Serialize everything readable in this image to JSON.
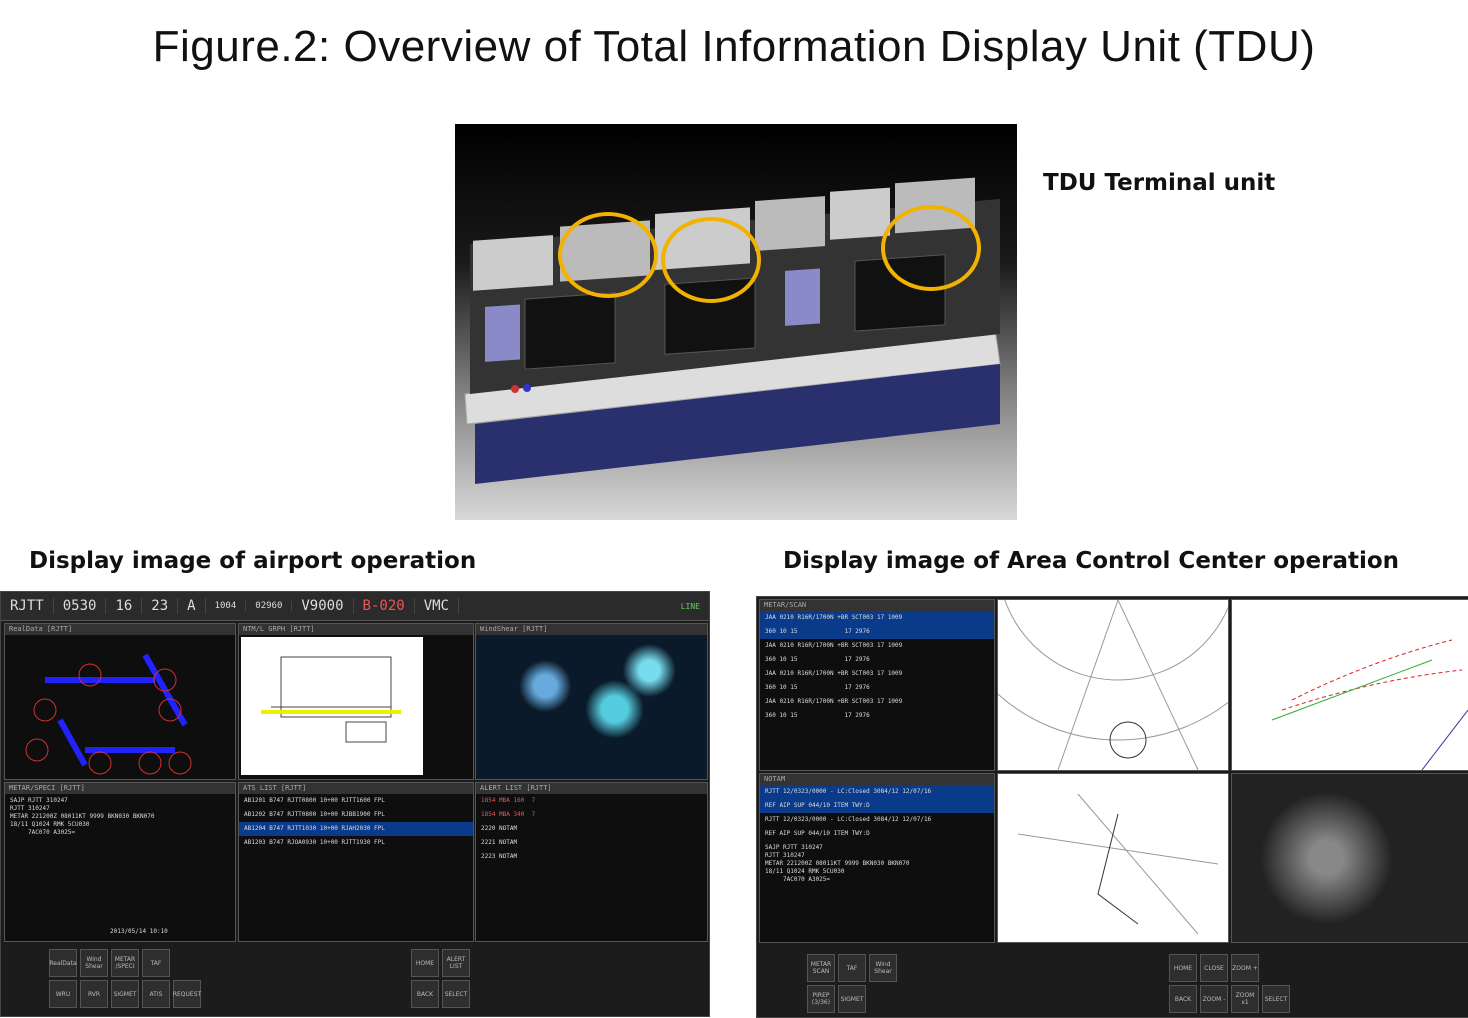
{
  "figure_title": "Figure.2: Overview of  Total Information Display Unit (TDU)",
  "captions": {
    "tdu_terminal": "TDU Terminal unit",
    "airport": "Display image of airport operation",
    "acc": "Display image of Area Control Center operation"
  },
  "airport_screen": {
    "topbar": [
      "RJTT",
      "0530",
      "16",
      "23",
      "A",
      "1004",
      "02960",
      "V9000",
      "B-020",
      "VMC",
      "LINE"
    ],
    "panels": {
      "realdata": "RealData [RJTT]",
      "ntm": "NTM/L GRPH [RJTT]",
      "windshear": "WindShear [RJTT]",
      "metar": "METAR/SPECI [RJTT]",
      "ats": "ATS LIST [RJTT]",
      "alert": "ALERT LIST [RJTT]"
    },
    "metar_text": "SAJP RJTT 310247\nRJTT 310247\nMETAR 221200Z 08011KT 9999 BKN030 BKN070\n18/11 Q1024 RMK 5CU030\n     7AC070 A3025=",
    "ats_rows": [
      "AB1201 B747 RJTT0800 10+00 RJTT1600 FPL",
      "AB1202 B747 RJTT0800 10+00 RJBB1900 FPL",
      "AB1204 B747 RJTT1030 10+00 RJAH2030 FPL",
      "AB1203 B747 RJOA0930 10+00 RJTT1930 FPL"
    ],
    "alert_rows": [
      "1854 MBA 160  7",
      "1854 MBA 340  7",
      "2220 NOTAM",
      "2221 NOTAM",
      "2223 NOTAM"
    ],
    "timestamp": "2013/05/14 10:10",
    "buttons": [
      "RealData",
      "Wind Shear",
      "METAR /SPECI",
      "TAF",
      "WRU",
      "RVR",
      "SIGMET",
      "ATIS",
      "REQUEST",
      "HOME",
      "BACK",
      "ALERT LIST",
      "SELECT"
    ]
  },
  "acc_screen": {
    "panels": {
      "metar": "METAR/SCAN",
      "notam": "NOTAM"
    },
    "metar_rows": [
      "JAA 0210 R16R/1700N +BR SCT003 17 1009",
      "360 10 15             17 2976",
      "JAA 0210 R16R/1700N +BR SCT003 17 1009",
      "360 10 15             17 2976",
      "JAA 0210 R16R/1700N +BR SCT003 17 1009",
      "360 10 15             17 2976",
      "JAA 0210 R16R/1700N +BR SCT003 17 1009",
      "360 10 15             17 2976"
    ],
    "notam_rows": [
      "RJTT 12/0323/0000 - LC:Closed 3084/12 12/07/16",
      "REF AIP SUP 044/10 ITEM TWY:D",
      "RJTT 12/0323/0000 - LC:Closed 3084/12 12/07/16",
      "REF AIP SUP 044/10 ITEM TWY:D"
    ],
    "notam_text": "SAJP RJTT 310247\nRJTT 310247\nMETAR 221200Z 08011KT 9999 BKN030 BKN070\n18/11 Q1024 RMK 5CU030\n     7AC070 A3025=",
    "buttons": [
      "METAR SCAN",
      "TAF",
      "PIREP (3/36)",
      "SIGMET",
      "Wind Shear",
      "HOME",
      "BACK",
      "CLOSE",
      "ZOOM +",
      "ZOOM -",
      "ZOOM x1",
      "SELECT"
    ]
  }
}
